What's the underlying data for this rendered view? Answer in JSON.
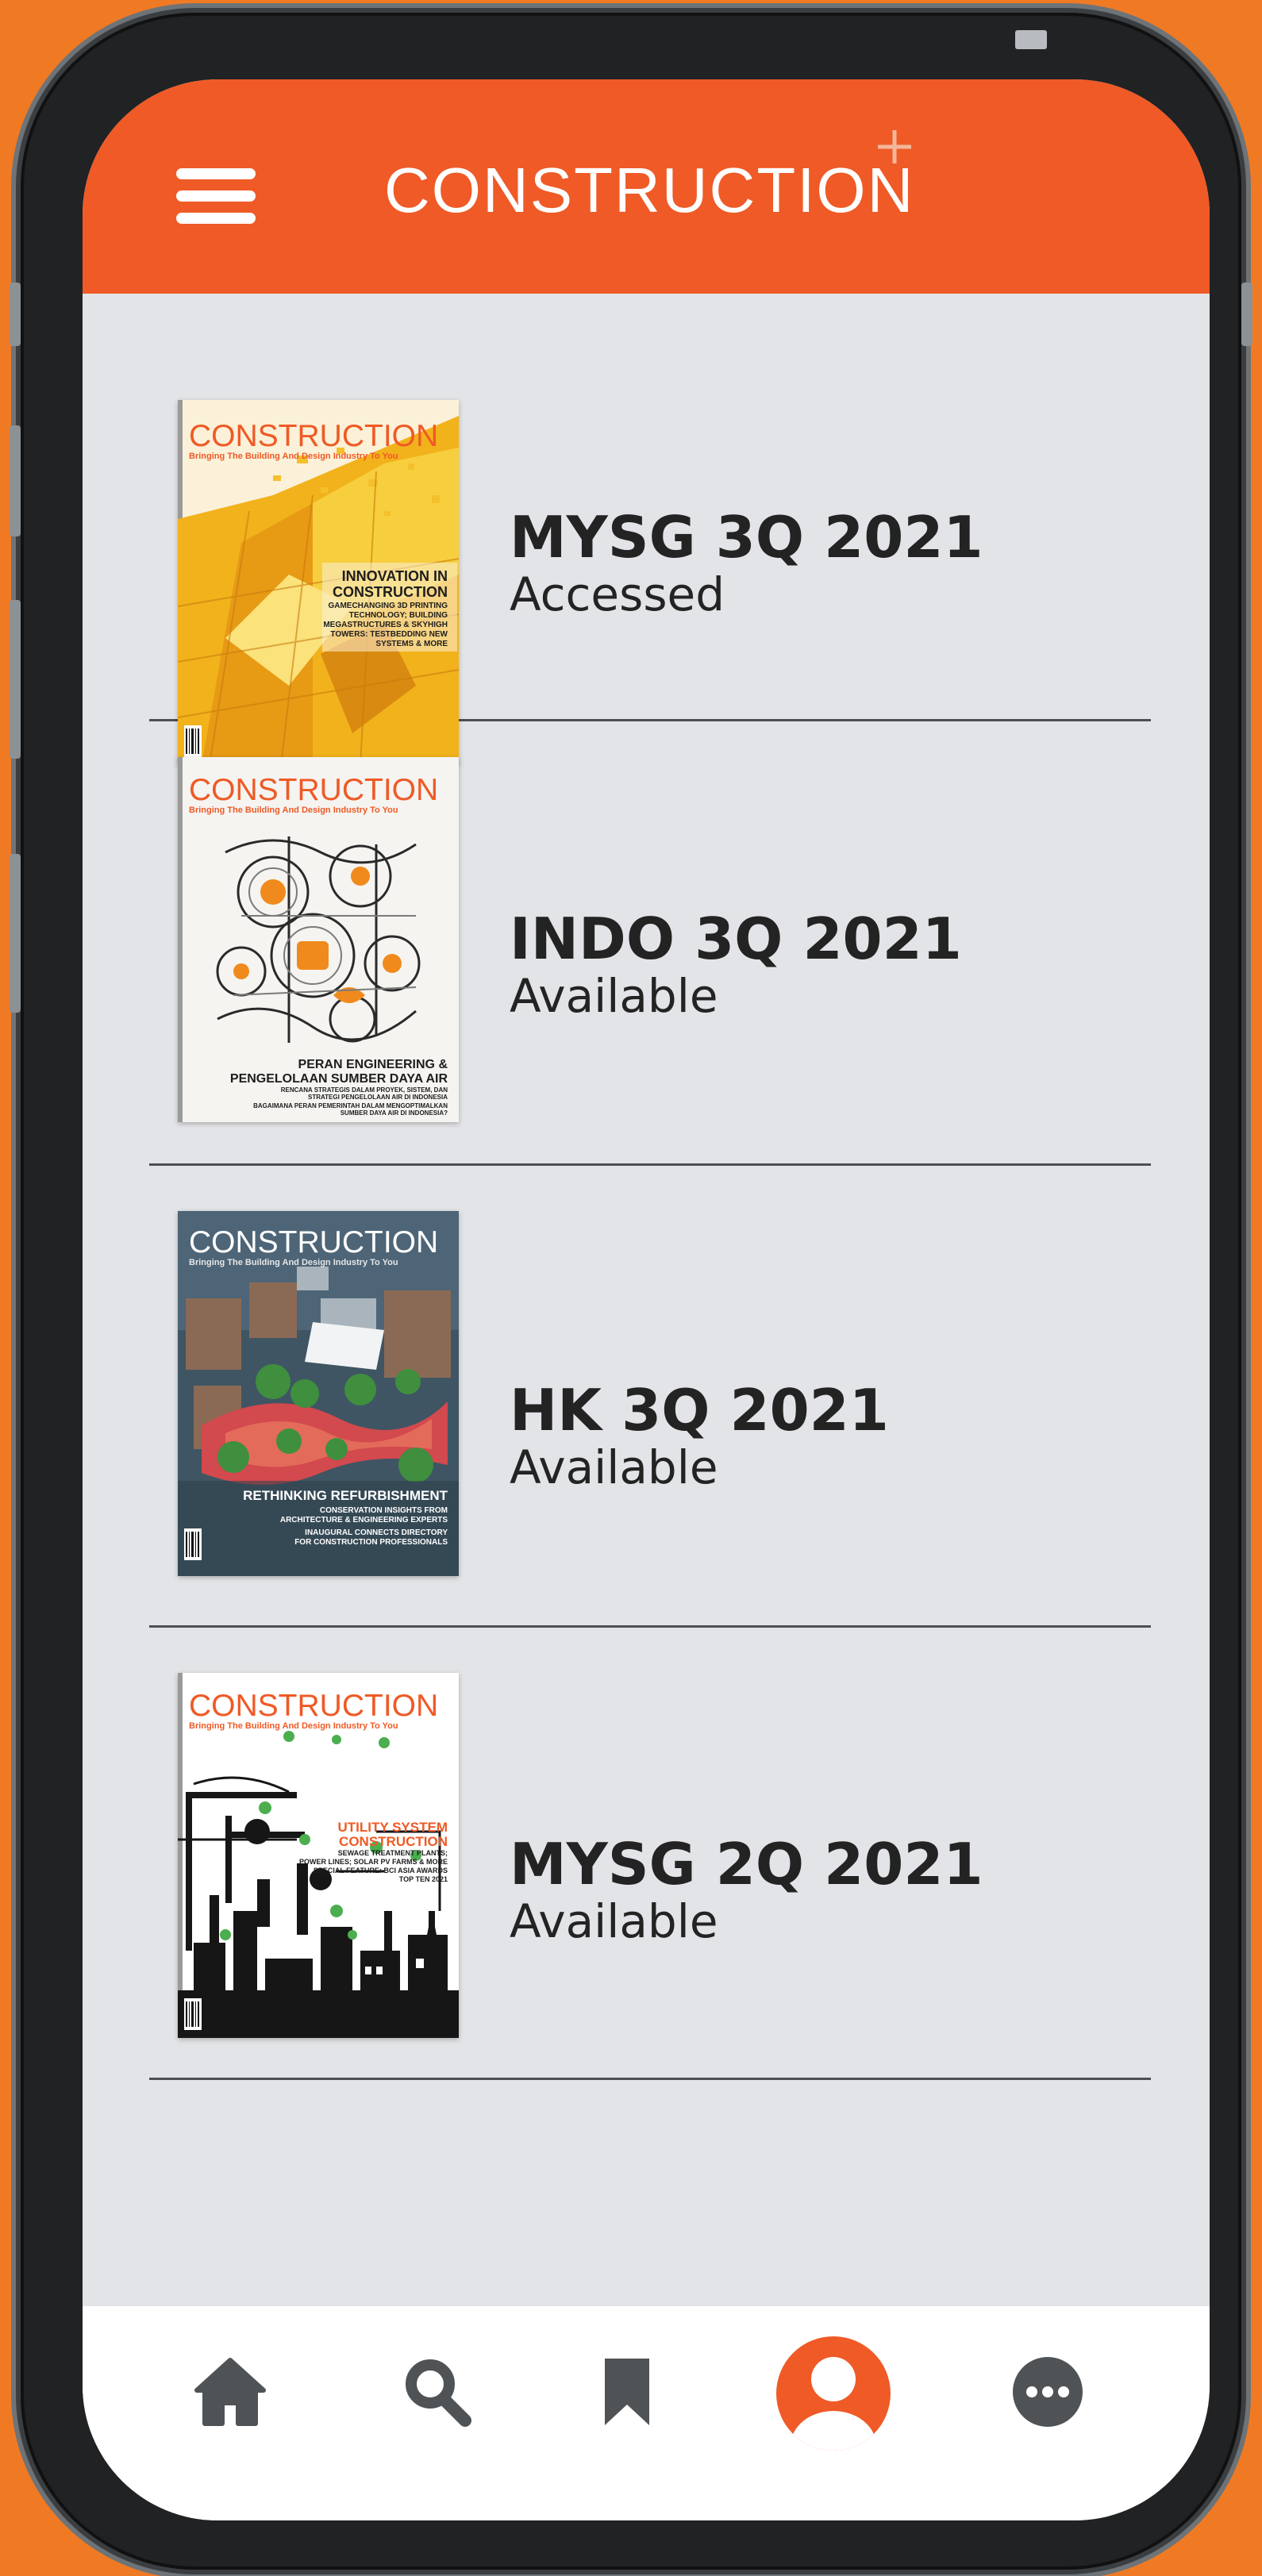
{
  "app": {
    "brand_name": "CONSTRUCTION",
    "brand_mark": "+",
    "accent_color": "#ef5a26",
    "background_color": "#f07a23"
  },
  "header": {
    "menu_icon": "hamburger-menu-icon"
  },
  "issues": [
    {
      "title": "MYSG 3Q 2021",
      "status": "Accessed",
      "cover": {
        "masthead": "CONSTRUCTION",
        "tagline": "Bringing The Building And Design Industry To You",
        "headline": [
          "INNOVATION IN",
          "CONSTRUCTION"
        ],
        "subtext": [
          "GAMECHANGING 3D PRINTING",
          "TECHNOLOGY; BUILDING",
          "MEGASTRUCTURES & SKYHIGH",
          "TOWERS: TESTBEDDING NEW",
          "SYSTEMS & MORE"
        ]
      }
    },
    {
      "title": "INDO 3Q 2021",
      "status": "Available",
      "cover": {
        "masthead": "CONSTRUCTION",
        "tagline": "Bringing The Building And Design Industry To You",
        "headline": [
          "PERAN ENGINEERING &",
          "PENGELOLAAN SUMBER DAYA AIR"
        ],
        "subtext": [
          "RENCANA STRATEGIS DALAM PROYEK, SISTEM, DAN",
          "STRATEGI PENGELOLAAN AIR DI INDONESIA",
          "BAGAIMANA PERAN PEMERINTAH DALAM MENGOPTIMALKAN",
          "SUMBER DAYA AIR DI INDONESIA?"
        ]
      }
    },
    {
      "title": "HK 3Q 2021",
      "status": "Available",
      "cover": {
        "masthead": "CONSTRUCTION",
        "tagline": "Bringing The Building And Design Industry To You",
        "headline": [
          "RETHINKING REFURBISHMENT"
        ],
        "subtext": [
          "CONSERVATION INSIGHTS FROM",
          "ARCHITECTURE & ENGINEERING EXPERTS",
          "INAUGURAL CONNECTS DIRECTORY",
          "FOR CONSTRUCTION PROFESSIONALS"
        ]
      }
    },
    {
      "title": "MYSG 2Q 2021",
      "status": "Available",
      "cover": {
        "masthead": "CONSTRUCTION",
        "tagline": "Bringing The Building And Design Industry To You",
        "headline": [
          "UTILITY SYSTEM",
          "CONSTRUCTION"
        ],
        "subtext": [
          "SEWAGE TREATMENT PLANTS;",
          "POWER LINES; SOLAR PV FARMS & MORE",
          "SPECIAL FEATURE: BCI ASIA AWARDS",
          "TOP TEN 2021"
        ]
      }
    }
  ],
  "bottom_nav": [
    {
      "icon": "home-icon",
      "active": false
    },
    {
      "icon": "search-icon",
      "active": false
    },
    {
      "icon": "bookmark-icon",
      "active": false
    },
    {
      "icon": "profile-icon",
      "active": true
    },
    {
      "icon": "more-icon",
      "active": false
    }
  ]
}
